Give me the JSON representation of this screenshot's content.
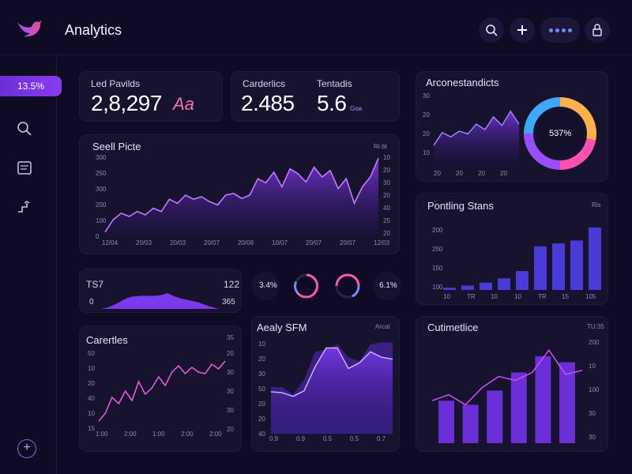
{
  "header": {
    "app_title": "Analytics",
    "buttons": [
      "search",
      "add",
      "toggle",
      "notifications"
    ]
  },
  "sidebar": {
    "badge": "13.5%",
    "icons": [
      "search-icon",
      "document-icon",
      "link-icon"
    ],
    "add_label": "+"
  },
  "stats": [
    {
      "label": "Led Pavilds",
      "value": "2,8,297",
      "extra": "Aa"
    },
    {
      "label": "Carderlics",
      "value": "2.485"
    },
    {
      "label": "Tentadis",
      "value": "5.6",
      "extra": "Goa"
    }
  ],
  "main_chart": {
    "title": "Seell Picte",
    "corner": "Rr.bt",
    "y_ticks": [
      "300",
      "250",
      "300",
      "200",
      "100",
      "0"
    ],
    "y_ticks_right": [
      "10",
      "20",
      "30",
      "20",
      "40",
      "25",
      "20"
    ],
    "x_ticks": [
      "12/04",
      "20/03",
      "20/03",
      "20/07",
      "20/08",
      "10/07",
      "20/07",
      "20/07",
      "12/03"
    ],
    "values": [
      5,
      20,
      28,
      24,
      30,
      26,
      34,
      30,
      45,
      40,
      50,
      45,
      48,
      42,
      38,
      50,
      52,
      46,
      50,
      70,
      65,
      78,
      60,
      82,
      76,
      66,
      84,
      72,
      80,
      58,
      70,
      40,
      60,
      72,
      95
    ]
  },
  "mini_area": {
    "title": "TS7",
    "left_val": "0",
    "right_top": "122",
    "right_bottom": "365"
  },
  "rings": [
    {
      "label": "3.4%",
      "percent": 0.6,
      "color": "#ff5aa8"
    },
    {
      "label": "",
      "percent": 0.7,
      "color": "#6d8dff"
    },
    {
      "label": "6.1%",
      "percent": 0.5,
      "color": "#ff5aa8"
    }
  ],
  "bottom_left": {
    "title": "Carertles",
    "corner": "35",
    "y_ticks": [
      "50",
      "10",
      "20",
      "40",
      "10",
      "15"
    ],
    "y_ticks_right": [
      "20",
      "30",
      "30",
      "30",
      "20"
    ],
    "x_ticks": [
      "1:00",
      "2:00",
      "1:00",
      "2:00",
      "2:00"
    ],
    "values": [
      10,
      20,
      40,
      32,
      48,
      36,
      60,
      44,
      52,
      66,
      55,
      72,
      80,
      70,
      78,
      72,
      70,
      82,
      76,
      86
    ]
  },
  "bottom_mid": {
    "title": "Aealy SFM",
    "corner": "Arcat",
    "y_ticks": [
      "10",
      "20",
      "30",
      "50",
      "20",
      "20",
      "40"
    ],
    "x_ticks": [
      "0.9",
      "0.9",
      "0.5",
      "0.5",
      "0.7"
    ],
    "line": [
      45,
      44,
      40,
      46,
      72,
      92,
      92,
      70,
      76,
      88,
      82,
      80
    ],
    "area": [
      50,
      50,
      42,
      58,
      88,
      90,
      96,
      82,
      78,
      96,
      98,
      98
    ]
  },
  "top_right": {
    "title": "Arconestandicts",
    "y_ticks": [
      "30",
      "20",
      "20",
      "10"
    ],
    "x_ticks": [
      "20",
      "20",
      "20",
      "20"
    ],
    "values": [
      30,
      48,
      42,
      50,
      46,
      60,
      52,
      70,
      58,
      78,
      60
    ],
    "donut_label": "537%",
    "donut_segments": [
      {
        "value": 0.28,
        "color": "#ffb04a"
      },
      {
        "value": 0.22,
        "color": "#ff4fb0"
      },
      {
        "value": 0.25,
        "color": "#9a4dff"
      },
      {
        "value": 0.25,
        "color": "#3fa7ff"
      }
    ]
  },
  "mid_right": {
    "title": "Pontling Stans",
    "corner": "Ris",
    "y_ticks": [
      "200",
      "250",
      "150",
      "100"
    ],
    "x_ticks": [
      "10",
      "TR",
      "10",
      "10",
      "TR",
      "15",
      "105"
    ],
    "values": [
      3,
      6,
      10,
      16,
      26,
      60,
      64,
      68,
      86
    ]
  },
  "bottom_right": {
    "title": "Cutimetlice",
    "corner": "TU:35",
    "y_ticks_right": [
      "200",
      "10",
      "100",
      "30",
      "30"
    ],
    "bars": [
      42,
      38,
      52,
      70,
      86,
      80
    ],
    "line": [
      42,
      48,
      38,
      55,
      66,
      62,
      70,
      92,
      68,
      72
    ]
  }
}
